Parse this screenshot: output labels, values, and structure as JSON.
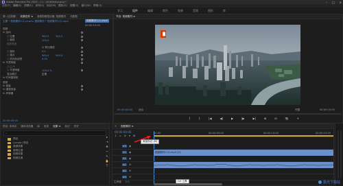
{
  "window": {
    "title": "Adobe Premiere Pro 2020 - C:\\...\\Untitled.prproj *",
    "controls": [
      "–",
      "□",
      "✕"
    ]
  },
  "menu": [
    "文件(F)",
    "编辑(E)",
    "剪辑(C)",
    "序列(S)",
    "标记(M)",
    "图形(G)",
    "视图(V)",
    "窗口(W)",
    "帮助(H)"
  ],
  "workspace_tabs": [
    {
      "label": "学习",
      "active": false
    },
    {
      "label": "组件",
      "active": true
    },
    {
      "label": "编辑",
      "active": false
    },
    {
      "label": "颜色",
      "active": false
    },
    {
      "label": "效果",
      "active": false
    },
    {
      "label": "音频",
      "active": false
    },
    {
      "label": "图形",
      "active": false
    },
    {
      "label": "库",
      "active": false
    }
  ],
  "effect_controls": {
    "tabs": [
      "源: (无剪辑)",
      "效果控件 ≡",
      "音频剪辑混合器: 视频素材",
      "元数据"
    ],
    "source_line": "主要 * 视频素材1(1).mp4 ▸ 视频素材 * 视频素材1(1).mp4",
    "clip_label": "视频素材1(1).mp4",
    "time_start": "00:00:00:00",
    "time_end": "00:00:15:00",
    "section_video": "视频",
    "rows": [
      {
        "name": "fx 运动",
        "v1": "",
        "v2": "",
        "indent": 0
      },
      {
        "name": "○ 位置",
        "v1": "960.0",
        "v2": "540.0",
        "indent": 1
      },
      {
        "name": "○ 缩放",
        "v1": "100.0",
        "v2": "",
        "indent": 1
      },
      {
        "name": "  缩放宽度",
        "v1": "",
        "v2": "",
        "indent": 1
      },
      {
        "name": "",
        "v1": "☑ 等比缩放",
        "v2": "",
        "indent": 1
      },
      {
        "name": "○ 旋转",
        "v1": "0.0",
        "v2": "",
        "indent": 1
      },
      {
        "name": "○ 锚点",
        "v1": "960.0",
        "v2": "540.0",
        "indent": 1
      },
      {
        "name": "○ 防闪烁滤镜",
        "v1": "0.00",
        "v2": "",
        "indent": 1
      },
      {
        "name": "fx 不透明度",
        "v1": "",
        "v2": "",
        "indent": 0
      },
      {
        "name": "○ □ ✎",
        "v1": "",
        "v2": "",
        "indent": 1
      },
      {
        "name": "○ 不透明度",
        "v1": "100.0 %",
        "v2": "",
        "indent": 1
      },
      {
        "name": "  混合模式",
        "v1": "正常",
        "v2": "",
        "indent": 1
      },
      {
        "name": "fx 时间重映射",
        "v1": "",
        "v2": "",
        "indent": 0
      }
    ],
    "section_audio": "音频",
    "audio_rows": [
      "fx 音量",
      "fx 通道音量",
      "fx 声像器"
    ],
    "bottom_time": "00:00:00:00"
  },
  "program": {
    "title": "节目: 视频素材 ≡",
    "timecode_left": "00:00:00:00",
    "fit": "适合",
    "quality": "完整",
    "timecode_right": "00:00:15:00",
    "transport": [
      "{",
      "}",
      "|◀",
      "◀|",
      "▶",
      "|▶",
      "▶|",
      "⊞",
      "⊟",
      "📷",
      "+"
    ]
  },
  "project": {
    "tabs": [
      "项目: 未命名",
      "媒体浏览器",
      "库",
      "信息",
      "效果 ≡",
      "标记",
      "历史"
    ],
    "search_placeholder": "",
    "items": [
      "预设",
      "Lumetri 预设",
      "音频效果",
      "音频过渡",
      "视频效果",
      "视频过渡"
    ]
  },
  "tools": [
    "▸",
    "⇥",
    "✥",
    "⇿",
    "✎",
    "✋",
    "T"
  ],
  "timeline": {
    "title": "视频素材 ≡",
    "timecode": "00:00:00:00",
    "ruler_labels": [
      "00:00",
      "00:00:05:00",
      "00:00:10:00",
      "00:00:15:00"
    ],
    "tooltip_top": "添加标记 (M)",
    "tooltip_bottom": "(V) 工具",
    "tracks": [
      {
        "name": "V3",
        "type": "video"
      },
      {
        "name": "V2",
        "type": "video"
      },
      {
        "name": "V1",
        "type": "video"
      },
      {
        "name": "A1",
        "type": "audio"
      },
      {
        "name": "A2",
        "type": "audio"
      },
      {
        "name": "A3",
        "type": "audio"
      }
    ],
    "track_header_labels": [
      "V3",
      "V2",
      "V1",
      "A1",
      "A2",
      "A3"
    ],
    "video_clip_label": "视频素材1(1).mp4 [V]",
    "text_clip_label": "fx",
    "master": "主声道",
    "master_value": "0.0"
  },
  "watermark": "极光下载站",
  "colors": {
    "accent": "#4a8fdc",
    "video_clip": "#6a8fc9",
    "audio_clip": "#6a8fc9",
    "text_clip": "#b080c0",
    "arrow": "#e02020"
  }
}
